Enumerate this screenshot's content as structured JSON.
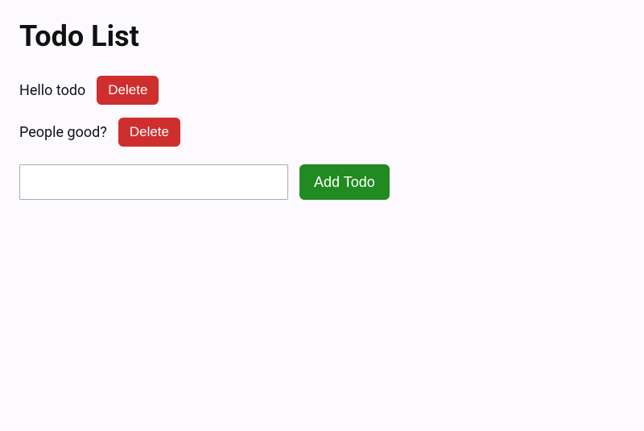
{
  "title": "Todo List",
  "todos": [
    {
      "text": "Hello todo",
      "delete_label": "Delete"
    },
    {
      "text": "People good?",
      "delete_label": "Delete"
    }
  ],
  "input_value": "",
  "add_label": "Add Todo"
}
